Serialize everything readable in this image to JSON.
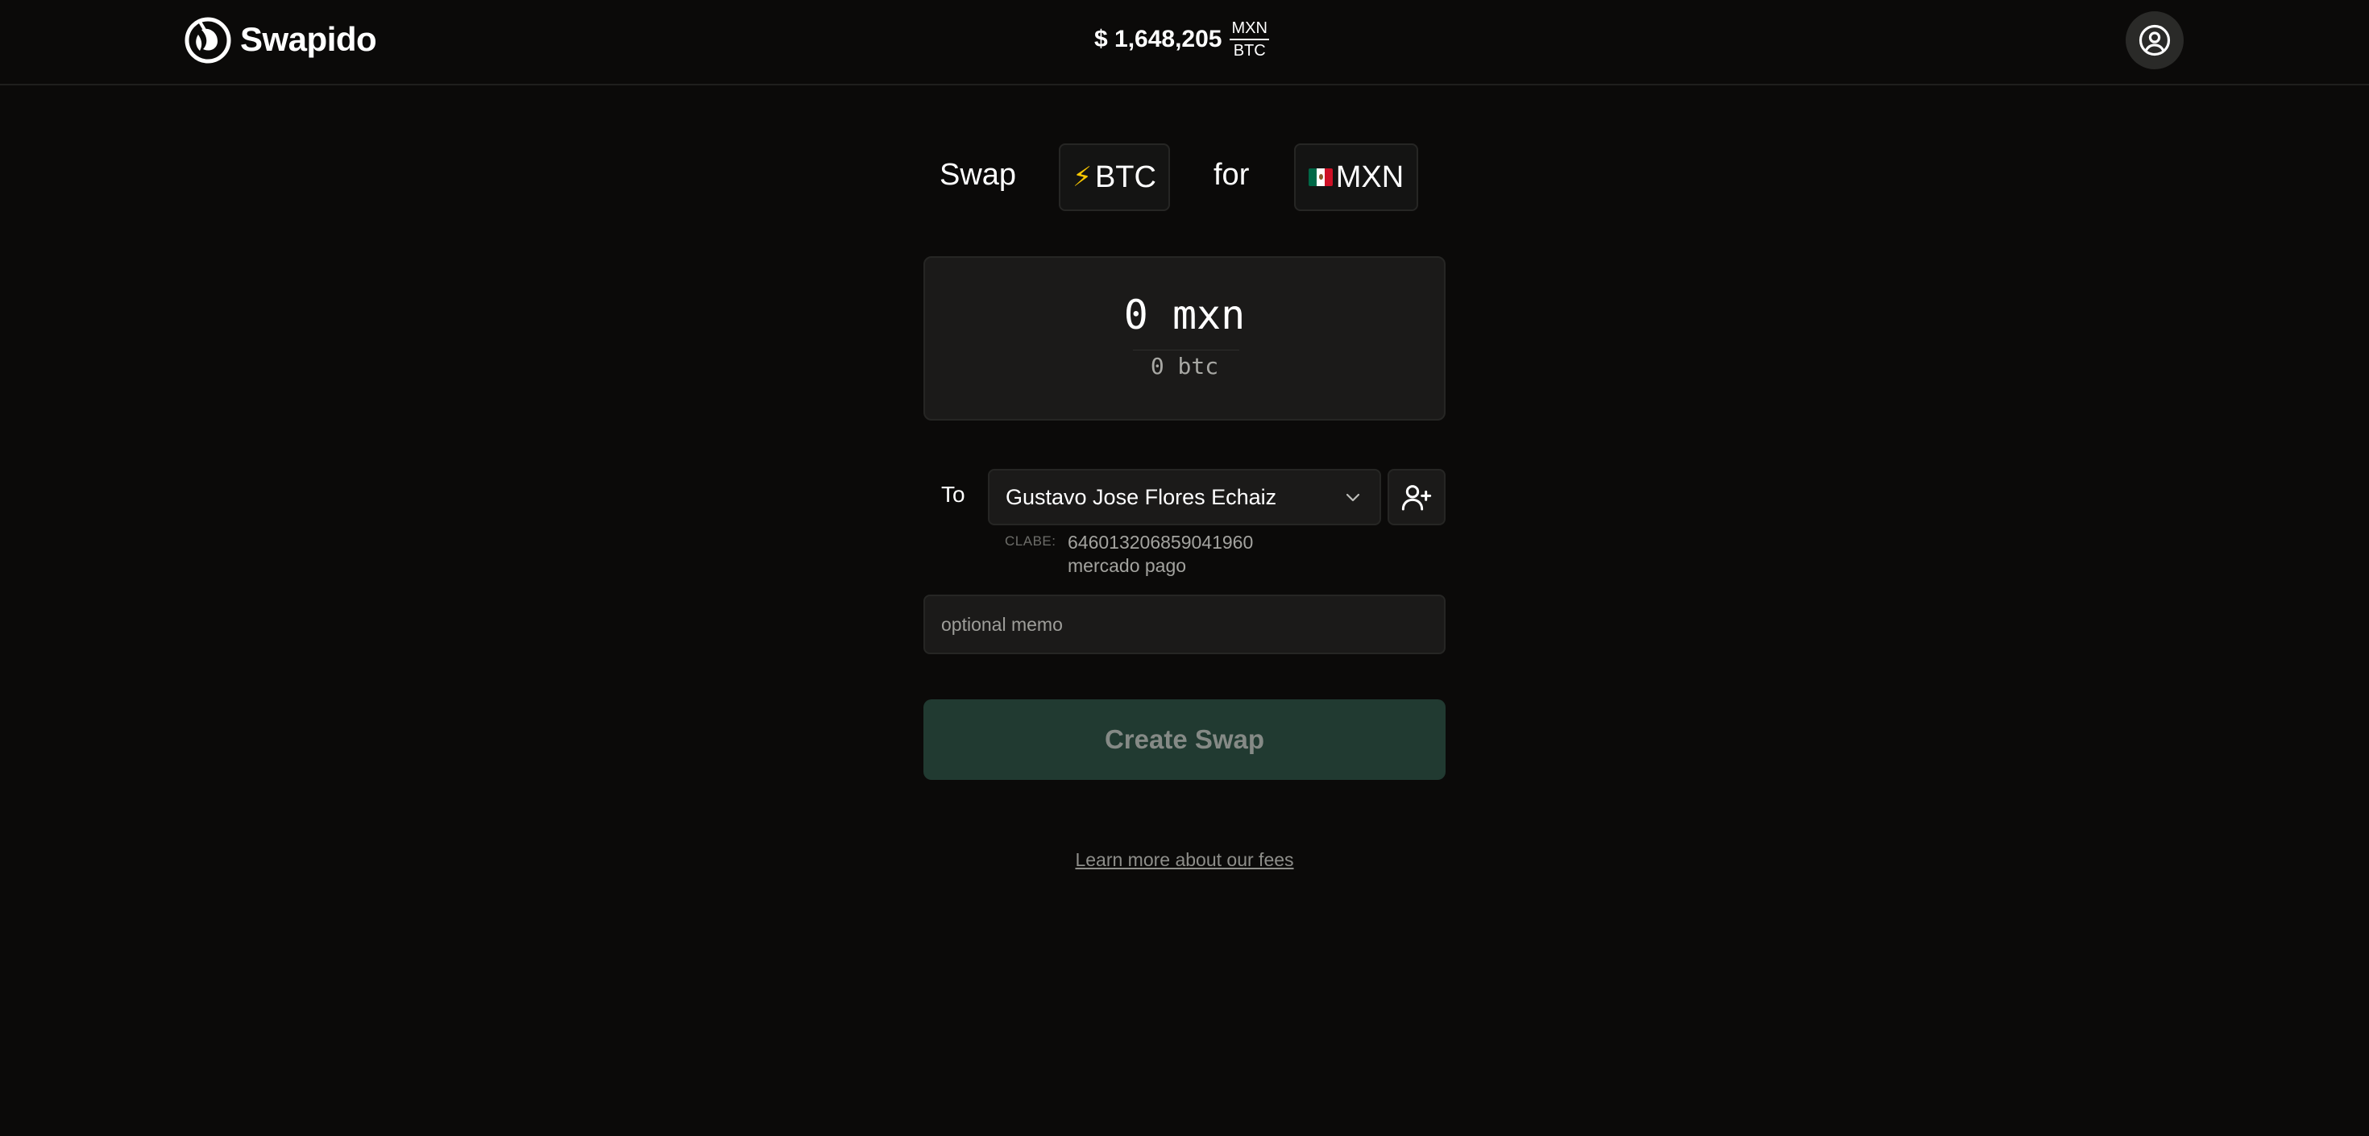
{
  "header": {
    "brand": "Swapido",
    "rate": {
      "value": "$ 1,648,205",
      "numerator": "MXN",
      "denominator": "BTC"
    },
    "profile_icon": "user-circle-icon"
  },
  "swap": {
    "swap_word": "Swap",
    "from_currency": "BTC",
    "from_icon": "lightning-bolt-icon",
    "for_word": "for",
    "to_currency": "MXN",
    "to_icon": "mexico-flag-icon"
  },
  "amount": {
    "primary": "0 mxn",
    "secondary": "0 btc"
  },
  "recipient": {
    "to_label": "To",
    "selected_name": "Gustavo Jose Flores Echaiz",
    "clabe_label": "CLABE:",
    "clabe_value": "646013206859041960",
    "bank": "mercado pago",
    "add_icon": "user-plus-icon"
  },
  "memo": {
    "placeholder": "optional memo",
    "value": ""
  },
  "actions": {
    "create_label": "Create Swap",
    "fees_link": "Learn more about our fees"
  },
  "colors": {
    "background": "#0b0a09",
    "panel": "#1b1a19",
    "border": "#262624",
    "create_button": "#213a31",
    "bolt": "#f7c600"
  }
}
